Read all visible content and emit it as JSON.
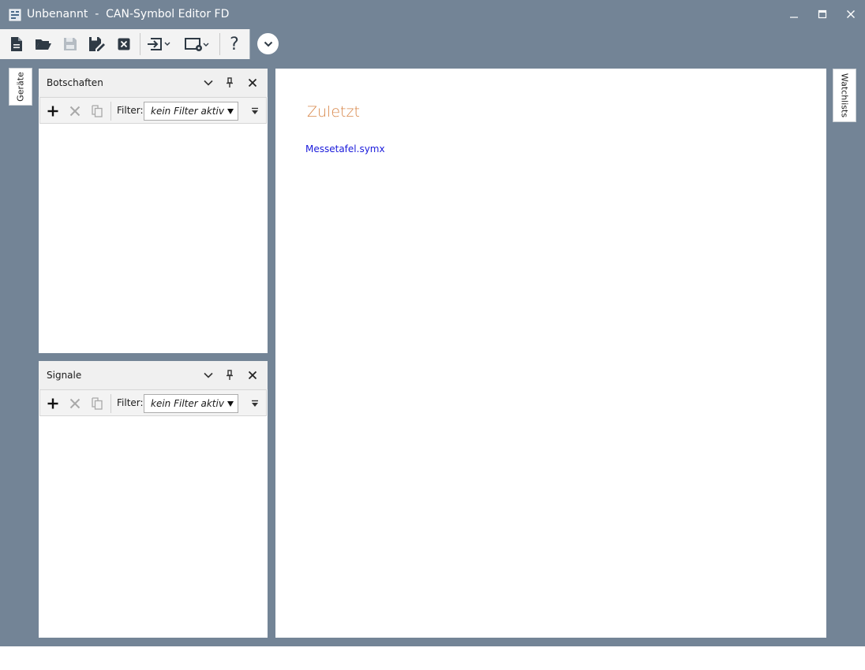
{
  "window": {
    "title": "Unbenannt  -  CAN-Symbol Editor FD"
  },
  "toolbar": {
    "buttons": [
      {
        "name": "new-file",
        "icon": "file-icon"
      },
      {
        "name": "open",
        "icon": "folder-open-icon"
      },
      {
        "name": "save",
        "icon": "save-icon"
      },
      {
        "name": "save-as",
        "icon": "save-as-icon"
      },
      {
        "name": "close",
        "icon": "close-box-icon"
      },
      {
        "name": "import",
        "icon": "import-icon"
      },
      {
        "name": "device-settings",
        "icon": "device-gear-icon"
      },
      {
        "name": "help",
        "icon": "help-icon"
      }
    ],
    "help_label": "?"
  },
  "left_tab": {
    "label": "Geräte"
  },
  "right_tab": {
    "label": "Watchlists"
  },
  "panels": {
    "messages": {
      "title": "Botschaften",
      "filter_label": "Filter:",
      "filter_value": "kein Filter aktiv"
    },
    "signals": {
      "title": "Signale",
      "filter_label": "Filter:",
      "filter_value": "kein Filter aktiv"
    }
  },
  "start_page": {
    "heading": "Zuletzt",
    "recent_files": [
      "Messetafel.symx"
    ]
  },
  "colors": {
    "window_bg": "#738496",
    "heading": "#d8874a",
    "link": "#1a1adb"
  }
}
